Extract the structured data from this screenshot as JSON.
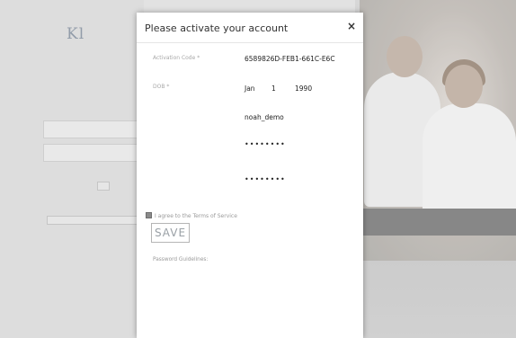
{
  "background": {
    "logo": "Kl",
    "tagline": "",
    "subtitle": "",
    "user_id_placeholder": "",
    "password_placeholder": "",
    "login_label": "",
    "register_label": "",
    "link1": "",
    "link2": "",
    "footer": ""
  },
  "modal": {
    "title": "Please activate your account",
    "close_icon": "×",
    "fields": [
      {
        "label": "Activation Code *",
        "value": "6589826D-FEB1-661C-E6C"
      },
      {
        "label": "DOB *",
        "dob_month": "Jan",
        "dob_day": "1",
        "dob_year": "1990"
      },
      {
        "label": "",
        "value": "noah_demo"
      },
      {
        "label": "",
        "value": "••••••••"
      },
      {
        "label": "",
        "value": "••••••••"
      }
    ],
    "terms_label": "I agree to the Terms of Service",
    "save_label": "SAVE",
    "guidelines_title": "Password Guidelines:",
    "guidelines": [
      "",
      "",
      "",
      "",
      "",
      "",
      "",
      "",
      ""
    ]
  },
  "colors": {
    "modal_bg": "#ffffff",
    "checkbox": "#8a8a8a",
    "save_text": "#9aa0a6"
  }
}
